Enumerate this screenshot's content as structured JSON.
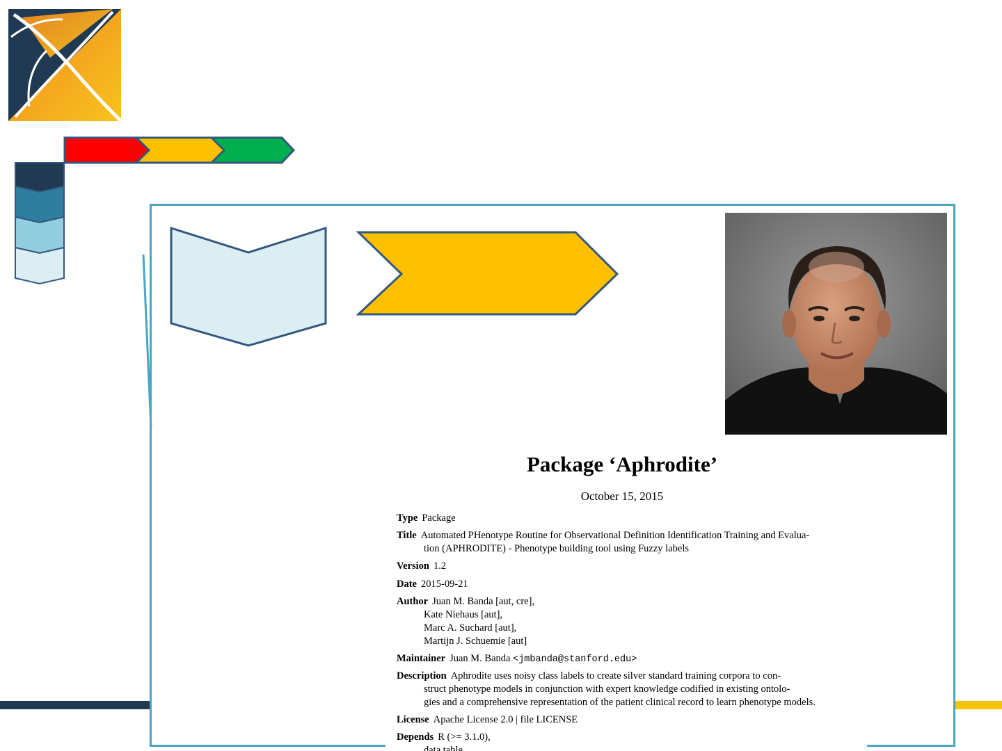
{
  "slide": {
    "colors": {
      "navy": "#1f3a52",
      "teal_frame": "#4aa6c0",
      "red": "#ff0000",
      "amber": "#ffc000",
      "green": "#00b050",
      "pale_blue": "#daeef4",
      "gold_bar": "#f5c400",
      "outline": "#34587d"
    },
    "logo": {
      "icon": "ohdsi-logo-icon"
    },
    "progress_arrows": [
      "red-arrow",
      "amber-arrow",
      "green-arrow"
    ],
    "photo": {
      "icon": "portrait-photo"
    }
  },
  "doc": {
    "title": "Package ‘Aphrodite’",
    "date": "October 15, 2015",
    "fields": {
      "type_label": "Type",
      "type_value": "Package",
      "title_label": "Title",
      "title_line1": "Automated PHenotype Routine for Observational Definition Identification Training and Evalua-",
      "title_line2": "tion (APHRODITE) - Phenotype building tool using Fuzzy labels",
      "version_label": "Version",
      "version_value": "1.2",
      "date_label": "Date",
      "date_value": "2015-09-21",
      "author_label": "Author",
      "author_line1": "Juan M. Banda [aut, cre],",
      "author_line2": "Kate Niehaus [aut],",
      "author_line3": "Marc A. Suchard [aut],",
      "author_line4": "Martijn J. Schuemie [aut]",
      "maintainer_label": "Maintainer",
      "maintainer_name": "Juan M. Banda",
      "maintainer_email": "<jmbanda@stanford.edu>",
      "description_label": "Description",
      "description_line1": "Aphrodite uses noisy class labels to create silver standard training corpora to con-",
      "description_line2": "struct phenotype models in conjunction with expert knowledge codified in existing ontolo-",
      "description_line3": "gies and a comprehensive representation of the patient clinical record to learn phenotype models.",
      "license_label": "License",
      "license_value": "Apache License 2.0 | file LICENSE",
      "depends_label": "Depends",
      "depends_line1": "R (>= 3.1.0),",
      "depends_line2": "data.table,"
    }
  }
}
